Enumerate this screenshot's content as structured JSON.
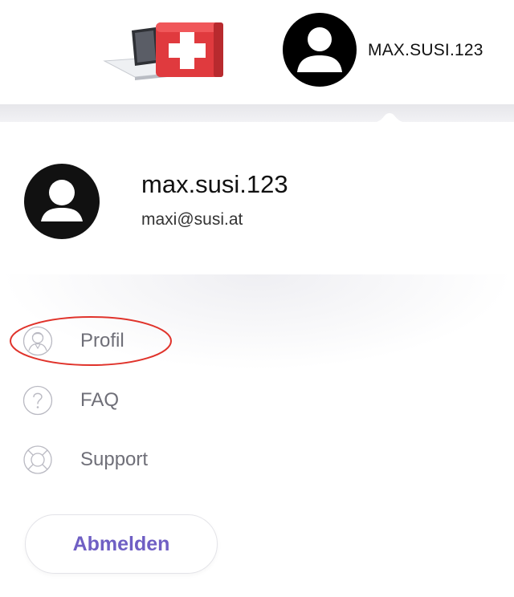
{
  "header": {
    "logo_icon": "first-aid-laptop-icon",
    "avatar_icon": "user-avatar-icon",
    "username": "MAX.SUSI.123"
  },
  "dropdown": {
    "user": {
      "avatar_icon": "user-avatar-icon",
      "username": "max.susi.123",
      "email": "maxi@susi.at"
    },
    "menu": [
      {
        "label": "Profil",
        "icon": "user-profile-icon",
        "highlighted": true
      },
      {
        "label": "FAQ",
        "icon": "question-circle-icon"
      },
      {
        "label": "Support",
        "icon": "lifebuoy-icon"
      }
    ],
    "logout_label": "Abmelden"
  },
  "colors": {
    "accent": "#6f5fc4",
    "highlight_ring": "#e0332b",
    "first_aid_red": "#e03a3e",
    "menu_text": "#6f6f78"
  }
}
